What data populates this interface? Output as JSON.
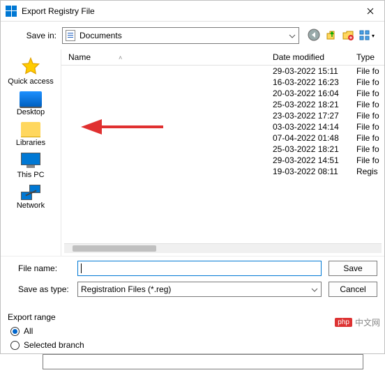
{
  "title": "Export Registry File",
  "save_in_label": "Save in:",
  "save_in_value": "Documents",
  "columns": {
    "name": "Name",
    "date": "Date modified",
    "type": "Type"
  },
  "rows": [
    {
      "date": "29-03-2022 15:11",
      "type": "File fo"
    },
    {
      "date": "16-03-2022 16:23",
      "type": "File fo"
    },
    {
      "date": "20-03-2022 16:04",
      "type": "File fo"
    },
    {
      "date": "25-03-2022 18:21",
      "type": "File fo"
    },
    {
      "date": "23-03-2022 17:27",
      "type": "File fo"
    },
    {
      "date": "03-03-2022 14:14",
      "type": "File fo"
    },
    {
      "date": "07-04-2022 01:48",
      "type": "File fo"
    },
    {
      "date": "25-03-2022 18:21",
      "type": "File fo"
    },
    {
      "date": "29-03-2022 14:51",
      "type": "File fo"
    },
    {
      "date": "19-03-2022 08:11",
      "type": "Regis"
    }
  ],
  "places": {
    "quick": "Quick access",
    "desktop": "Desktop",
    "libraries": "Libraries",
    "thispc": "This PC",
    "network": "Network"
  },
  "form": {
    "filename_label": "File name:",
    "filename_value": "",
    "savetype_label": "Save as type:",
    "savetype_value": "Registration Files (*.reg)",
    "save_btn": "Save",
    "cancel_btn": "Cancel"
  },
  "export_range": {
    "title": "Export range",
    "all": "All",
    "selected": "Selected branch"
  },
  "watermark": {
    "logo": "php",
    "text": "中文网"
  }
}
